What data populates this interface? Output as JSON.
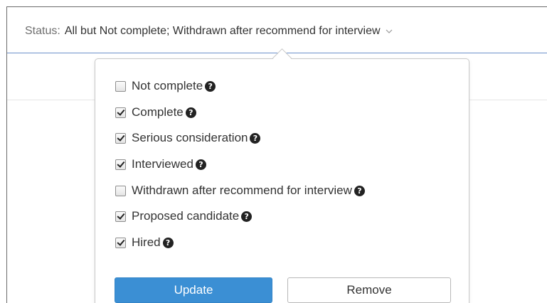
{
  "filter": {
    "label": "Status:",
    "value": "All but Not complete; Withdrawn after recommend for interview",
    "chevron_icon": "chevron-down-icon"
  },
  "options": [
    {
      "label": "Not complete",
      "checked": false
    },
    {
      "label": "Complete",
      "checked": true
    },
    {
      "label": "Serious consideration",
      "checked": true
    },
    {
      "label": "Interviewed",
      "checked": true
    },
    {
      "label": "Withdrawn after recommend for interview",
      "checked": false
    },
    {
      "label": "Proposed candidate",
      "checked": true
    },
    {
      "label": "Hired",
      "checked": true
    }
  ],
  "help_icon_glyph": "?",
  "buttons": {
    "update_label": "Update",
    "remove_label": "Remove"
  },
  "colors": {
    "accent": "#3b8fd4",
    "border": "#c8c8c8"
  }
}
